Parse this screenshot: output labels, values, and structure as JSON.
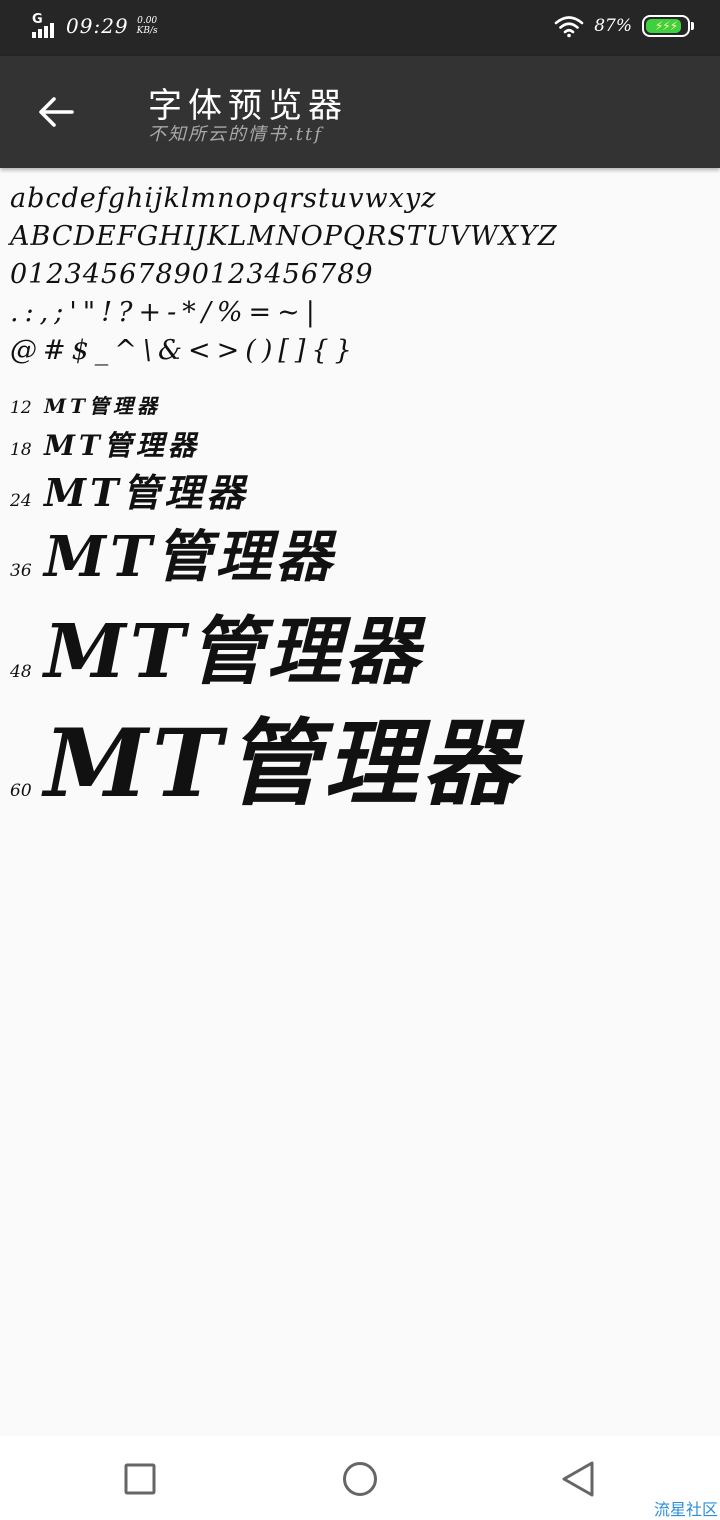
{
  "status_bar": {
    "network": "G",
    "time": "09:29",
    "speed_value": "0.00",
    "speed_unit": "KB/s",
    "battery_pct": "87%",
    "battery_level": 0.87
  },
  "app_bar": {
    "title": "字体预览器",
    "subtitle": "不知所云的情书.ttf"
  },
  "preview": {
    "lines": [
      "abcdefghijklmnopqrstuvwxyz",
      "ABCDEFGHIJKLMNOPQRSTUVWXYZ",
      "01234567890123456789",
      ".:,;'\"!?+-*/%=~|",
      "@#$_^\\&<>()[]{}"
    ],
    "samples": [
      {
        "size": "12",
        "text": "MT管理器"
      },
      {
        "size": "18",
        "text": "MT管理器"
      },
      {
        "size": "24",
        "text": "MT管理器"
      },
      {
        "size": "36",
        "text": "MT管理器"
      },
      {
        "size": "48",
        "text": "MT管理器"
      },
      {
        "size": "60",
        "text": "MT管理器"
      }
    ]
  },
  "watermark": "流星社区"
}
